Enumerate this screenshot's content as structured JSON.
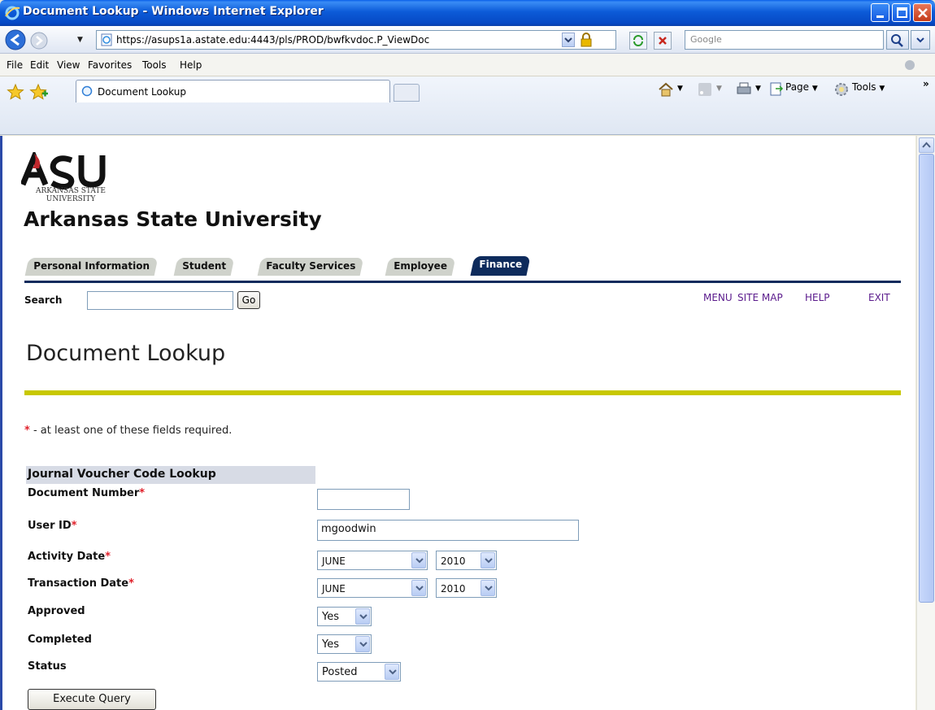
{
  "window": {
    "title": "Document Lookup - Windows Internet Explorer"
  },
  "address_bar": {
    "url": "https://asups1a.astate.edu:4443/pls/PROD/bwfkvdoc.P_ViewDoc",
    "search_placeholder": "Google"
  },
  "menu": {
    "items": [
      {
        "label": "File",
        "mnemonic": "F"
      },
      {
        "label": "Edit",
        "mnemonic": "E"
      },
      {
        "label": "View",
        "mnemonic": "V"
      },
      {
        "label": "Favorites",
        "mnemonic": "a"
      },
      {
        "label": "Tools",
        "mnemonic": "T"
      },
      {
        "label": "Help",
        "mnemonic": "H"
      }
    ]
  },
  "tabs": {
    "active_label": "Document Lookup"
  },
  "command_bar": {
    "page_label": "Page",
    "tools_label": "Tools"
  },
  "site": {
    "logo_letters": "ASU",
    "logo_subtitle_1": "ARKANSAS STATE",
    "logo_subtitle_2": "UNIVERSITY",
    "university_name": "Arkansas State University",
    "nav_tabs": [
      {
        "label": "Personal Information",
        "active": false
      },
      {
        "label": "Student",
        "active": false
      },
      {
        "label": "Faculty Services",
        "active": false
      },
      {
        "label": "Employee",
        "active": false
      },
      {
        "label": "Finance",
        "active": true
      }
    ],
    "search_label": "Search",
    "go_label": "Go",
    "top_links": [
      "MENU",
      "SITE MAP",
      "HELP",
      "EXIT"
    ]
  },
  "page": {
    "title": "Document Lookup",
    "required_note": " - at least one of these fields required.",
    "required_marker": "*",
    "form_header": "Journal Voucher Code Lookup",
    "fields": {
      "document_number": {
        "label": "Document Number",
        "value": ""
      },
      "user_id": {
        "label": "User ID",
        "value": "mgoodwin"
      },
      "activity_date": {
        "label": "Activity Date",
        "month": "JUNE",
        "year": "2010"
      },
      "transaction_date": {
        "label": "Transaction Date",
        "month": "JUNE",
        "year": "2010"
      },
      "approved": {
        "label": "Approved",
        "value": "Yes"
      },
      "completed": {
        "label": "Completed",
        "value": "Yes"
      },
      "status": {
        "label": "Status",
        "value": "Posted"
      }
    },
    "execute_label": "Execute Query"
  },
  "colors": {
    "nav_active": "#0e2b5c",
    "rule_yellow": "#c8c800",
    "required": "#e0202a",
    "link": "#5a1a8c"
  }
}
